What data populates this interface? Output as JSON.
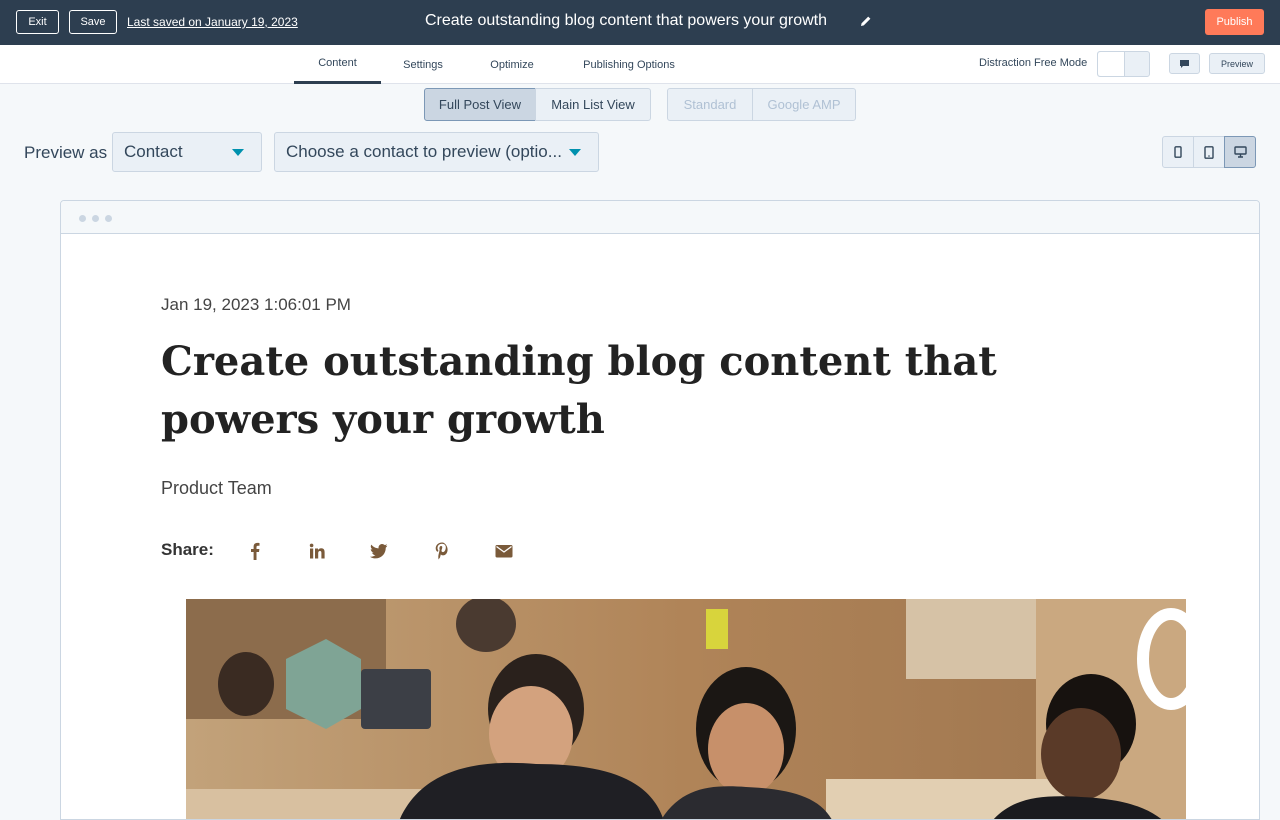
{
  "topbar": {
    "exit_label": "Exit",
    "save_label": "Save",
    "last_saved": "Last saved on January 19, 2023",
    "title": "Create outstanding blog content that powers your growth",
    "publish_label": "Publish"
  },
  "tabs": [
    {
      "label": "Content",
      "active": true
    },
    {
      "label": "Settings",
      "active": false
    },
    {
      "label": "Optimize",
      "active": false
    },
    {
      "label": "Publishing Options",
      "active": false
    }
  ],
  "distraction_free": {
    "label": "Distraction Free Mode",
    "enabled": false
  },
  "preview_button": "Preview",
  "views": {
    "full_post": "Full Post View",
    "main_list": "Main List View",
    "standard": "Standard",
    "amp": "Google AMP"
  },
  "preview_as": {
    "label": "Preview as",
    "type_value": "Contact",
    "contact_placeholder": "Choose a contact to preview (optio..."
  },
  "post": {
    "date": "Jan 19, 2023 1:06:01 PM",
    "heading": "Create outstanding blog content that powers your growth",
    "author": "Product Team",
    "share_label": "Share:"
  },
  "colors": {
    "topbar": "#2d3e50",
    "publish": "#ff7a59",
    "accent": "#0091ae",
    "share_icons": "#7a5a3a"
  }
}
